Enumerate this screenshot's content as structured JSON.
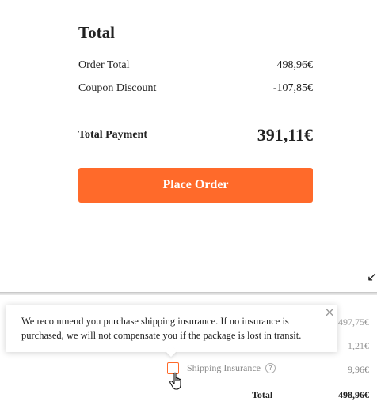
{
  "summary": {
    "title": "Total",
    "order_total_label": "Order Total",
    "order_total_value": "498,96€",
    "coupon_label": "Coupon Discount",
    "coupon_value": "-107,85€",
    "payment_label": "Total Payment",
    "payment_value": "391,11€",
    "place_order_label": "Place Order",
    "collapse_icon": "collapse-arrow-icon"
  },
  "background_values": {
    "value1": "497,75€",
    "value2": "1,21€"
  },
  "tooltip": {
    "text": "We recommend you purchase shipping insurance. If no insurance is purchased, we will not compensate you if the package is lost in transit.",
    "close_icon": "close-icon"
  },
  "insurance": {
    "label": "Shipping Insurance",
    "help_symbol": "?",
    "value": "9,96€",
    "checked": false
  },
  "final": {
    "label": "Total",
    "value": "498,96€"
  },
  "colors": {
    "accent": "#ff6a2a",
    "text": "#222222",
    "muted": "#8a8a8a"
  }
}
